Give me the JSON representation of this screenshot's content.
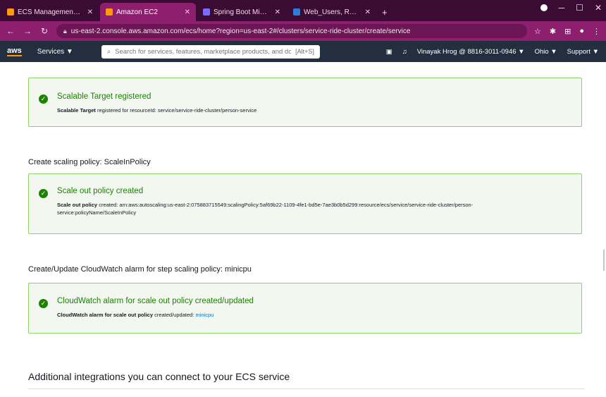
{
  "browser": {
    "tabs": [
      {
        "title": "ECS Management Console",
        "active": false,
        "favicon_color": "#ff9900"
      },
      {
        "title": "Amazon EC2",
        "active": true,
        "favicon_color": "#ff9900"
      },
      {
        "title": "Spring Boot Microservices AWS",
        "active": false,
        "favicon_color": "#7a6cff"
      },
      {
        "title": "Web_Users, Rotate (Contro",
        "active": false,
        "favicon_color": "#2f7bdc"
      }
    ],
    "url": "us-east-2.console.aws.amazon.com/ecs/home?region=us-east-2#/clusters/service-ride-cluster/create/service"
  },
  "aws_header": {
    "logo": "aws",
    "services_label": "Services ▼",
    "search_placeholder": "Search for services, features, marketplace products, and docs",
    "search_shortcut": "[Alt+S]",
    "account_label": "Vinayak Hrog @ 8816-3011-0946 ▼",
    "region_label": "Ohio ▼",
    "support_label": "Support ▼"
  },
  "main": {
    "flash1": {
      "title": "Scalable Target registered",
      "body_bold": "Scalable Target",
      "body_rest": " registered for resourceId: service/service-ride-cluster/person-service"
    },
    "section2_title": "Create scaling policy: ScaleInPolicy",
    "flash2": {
      "title": "Scale out policy created",
      "body_bold": "Scale out policy",
      "body_rest": " created: arn:aws:autoscaling:us-east-2:075883715549:scalingPolicy:5af69b22-1109-4fe1-bd5e-7ae3b0b5d299:resource/ecs/service/service-ride-cluster/person-service:policyName/ScaleInPolicy"
    },
    "section3_title": "Create/Update CloudWatch alarm for step scaling policy: minicpu",
    "flash3": {
      "title": "CloudWatch alarm for scale out policy created/updated",
      "body_bold": "CloudWatch alarm for scale out policy",
      "body_rest": " created/updated: ",
      "link": "minicpu"
    },
    "bottom_title": "Additional integrations you can connect to your ECS service"
  }
}
